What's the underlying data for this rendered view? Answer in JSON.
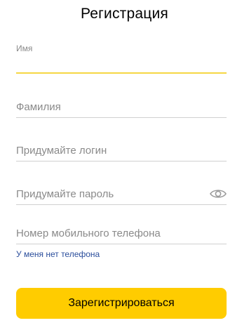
{
  "title": "Регистрация",
  "fields": {
    "first_name": {
      "label": "Имя",
      "value": ""
    },
    "last_name": {
      "placeholder": "Фамилия"
    },
    "login": {
      "placeholder": "Придумайте логин"
    },
    "password": {
      "placeholder": "Придумайте пароль",
      "icon": "eye-icon"
    },
    "phone": {
      "placeholder": "Номер мобильного телефона"
    }
  },
  "no_phone_link": "У меня нет телефона",
  "register_button": "Зарегистрироваться",
  "colors": {
    "accent": "#ffcc00",
    "active_underline": "#f6d744",
    "link": "#2b4e9c",
    "placeholder": "#8a8a8a",
    "divider": "#d0d0d0"
  }
}
